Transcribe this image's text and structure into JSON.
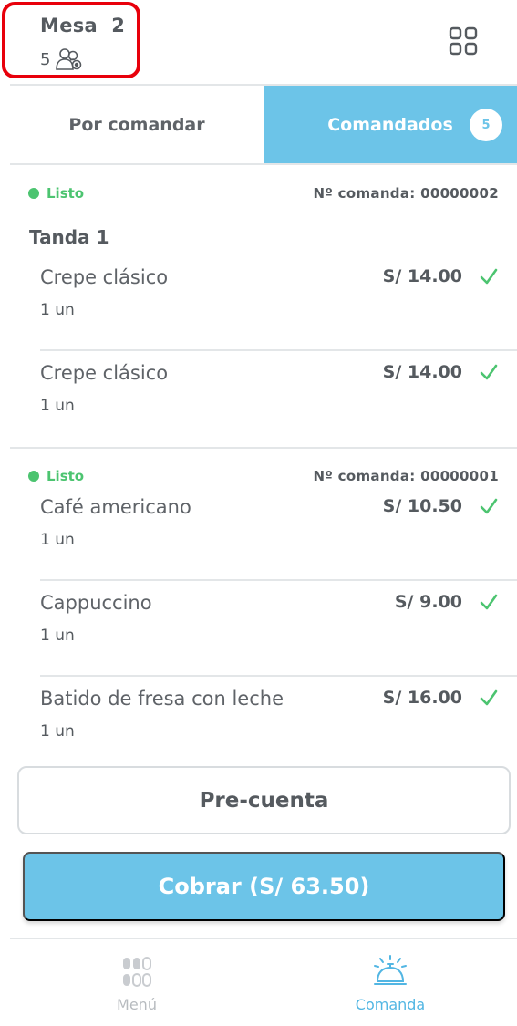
{
  "header": {
    "table_title": "Mesa  2",
    "guest_count": "5",
    "guest_icon": "people-icon",
    "menu_icon": "grid-icon"
  },
  "tabs": [
    {
      "label": "Por comandar",
      "active": false
    },
    {
      "label": "Comandados",
      "active": true,
      "count": "5"
    }
  ],
  "orders": [
    {
      "status": "Listo",
      "comanda": "Nº comanda: 00000002",
      "batch": "Tanda 1",
      "items": [
        {
          "name": "Crepe clásico",
          "qty": "1 un",
          "price": "S/ 14.00"
        },
        {
          "name": "Crepe clásico",
          "qty": "1 un",
          "price": "S/ 14.00"
        }
      ]
    },
    {
      "status": "Listo",
      "comanda": "Nº comanda: 00000001",
      "items": [
        {
          "name": "Café americano",
          "qty": "1 un",
          "price": "S/ 10.50"
        },
        {
          "name": "Cappuccino",
          "qty": "1 un",
          "price": "S/ 9.00"
        },
        {
          "name": "Batido de fresa con leche",
          "qty": "1 un",
          "price": "S/ 16.00"
        }
      ]
    }
  ],
  "actions": {
    "precuenta_label": "Pre-cuenta",
    "cobrar_label": "Cobrar (S/ 63.50)"
  },
  "bottom_nav": [
    {
      "label": "Menú",
      "icon": "menu-dots-icon",
      "active": false
    },
    {
      "label": "Comanda",
      "icon": "service-bell-icon",
      "active": true
    }
  ],
  "colors": {
    "accent": "#6cc4e8",
    "ready_green": "#4cc470",
    "highlight_red": "#e8000b",
    "text_gray": "#555a5f"
  }
}
